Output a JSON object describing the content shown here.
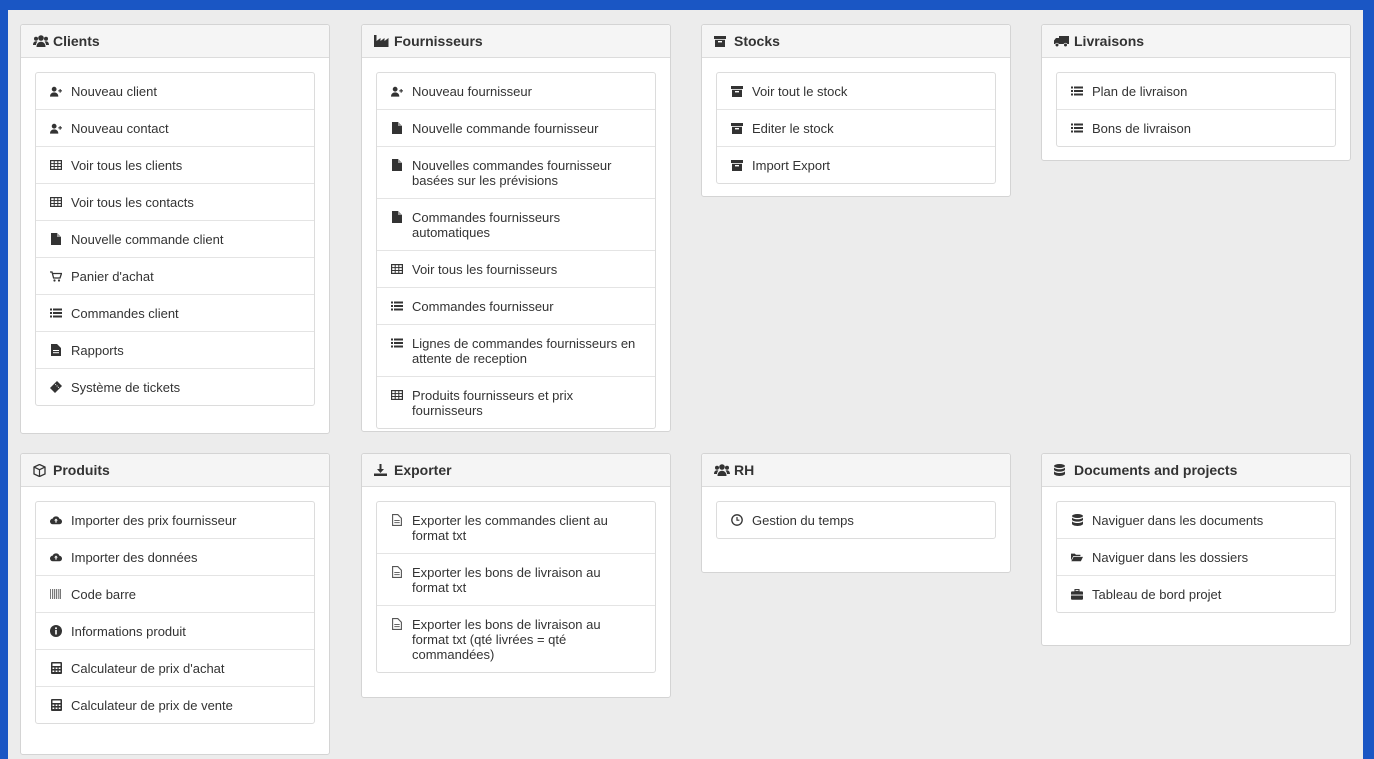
{
  "panels": [
    {
      "id": "clients",
      "title": "Clients",
      "items": [
        {
          "label": "Nouveau client"
        },
        {
          "label": "Nouveau contact"
        },
        {
          "label": "Voir tous les clients"
        },
        {
          "label": "Voir tous les contacts"
        },
        {
          "label": "Nouvelle commande client"
        },
        {
          "label": "Panier d'achat"
        },
        {
          "label": "Commandes client"
        },
        {
          "label": "Rapports"
        },
        {
          "label": "Système de tickets"
        }
      ]
    },
    {
      "id": "fournisseurs",
      "title": "Fournisseurs",
      "items": [
        {
          "label": "Nouveau fournisseur"
        },
        {
          "label": "Nouvelle commande fournisseur"
        },
        {
          "label": "Nouvelles commandes fournisseur basées sur les prévisions"
        },
        {
          "label": "Commandes fournisseurs automatiques"
        },
        {
          "label": "Voir tous les fournisseurs"
        },
        {
          "label": "Commandes fournisseur"
        },
        {
          "label": "Lignes de commandes fournisseurs en attente de reception"
        },
        {
          "label": "Produits fournisseurs et prix fournisseurs"
        }
      ]
    },
    {
      "id": "stocks",
      "title": "Stocks",
      "items": [
        {
          "label": "Voir tout le stock"
        },
        {
          "label": "Editer le stock"
        },
        {
          "label": "Import Export"
        }
      ]
    },
    {
      "id": "livraisons",
      "title": "Livraisons",
      "items": [
        {
          "label": "Plan de livraison"
        },
        {
          "label": "Bons de livraison"
        }
      ]
    },
    {
      "id": "produits",
      "title": "Produits",
      "items": [
        {
          "label": "Importer des prix fournisseur"
        },
        {
          "label": "Importer des données"
        },
        {
          "label": "Code barre"
        },
        {
          "label": "Informations produit"
        },
        {
          "label": "Calculateur de prix d'achat"
        },
        {
          "label": "Calculateur de prix de vente"
        }
      ]
    },
    {
      "id": "exporter",
      "title": "Exporter",
      "items": [
        {
          "label": "Exporter les commandes client au format txt"
        },
        {
          "label": "Exporter les bons de livraison au format txt"
        },
        {
          "label": "Exporter les bons de livraison au format txt (qté livrées = qté commandées)"
        }
      ]
    },
    {
      "id": "rh",
      "title": "RH",
      "items": [
        {
          "label": "Gestion du temps"
        }
      ]
    },
    {
      "id": "documents",
      "title": "Documents and projects",
      "items": [
        {
          "label": "Naviguer dans les documents"
        },
        {
          "label": "Naviguer dans les dossiers"
        },
        {
          "label": "Tableau de bord projet"
        }
      ]
    }
  ],
  "icons": {
    "clients": [
      "user-plus-icon",
      "user-plus-icon",
      "table-icon",
      "table-icon",
      "file-icon",
      "shopping-cart-icon",
      "list-icon",
      "report-icon",
      "ticket-icon"
    ],
    "fournisseurs": [
      "user-plus-icon",
      "file-icon",
      "file-icon",
      "file-icon",
      "table-icon",
      "list-icon",
      "list-icon",
      "table-icon"
    ],
    "stocks": [
      "archive-icon",
      "archive-icon",
      "archive-icon"
    ],
    "livraisons": [
      "list-icon",
      "list-icon"
    ],
    "produits": [
      "cloud-upload-icon",
      "cloud-upload-icon",
      "barcode-icon",
      "info-icon",
      "calculator-icon",
      "calculator-icon"
    ],
    "exporter": [
      "file-text-icon",
      "file-text-icon",
      "file-text-icon"
    ],
    "rh": [
      "clock-icon"
    ],
    "documents": [
      "database-icon",
      "folder-open-icon",
      "briefcase-icon"
    ]
  },
  "header_icons": {
    "clients": "users-icon",
    "fournisseurs": "industry-icon",
    "stocks": "archive-icon",
    "livraisons": "truck-icon",
    "produits": "cube-icon",
    "exporter": "download-icon",
    "rh": "users-icon",
    "documents": "database-icon"
  },
  "colors": {
    "frame": "#1a56c4",
    "background": "#ececec"
  }
}
